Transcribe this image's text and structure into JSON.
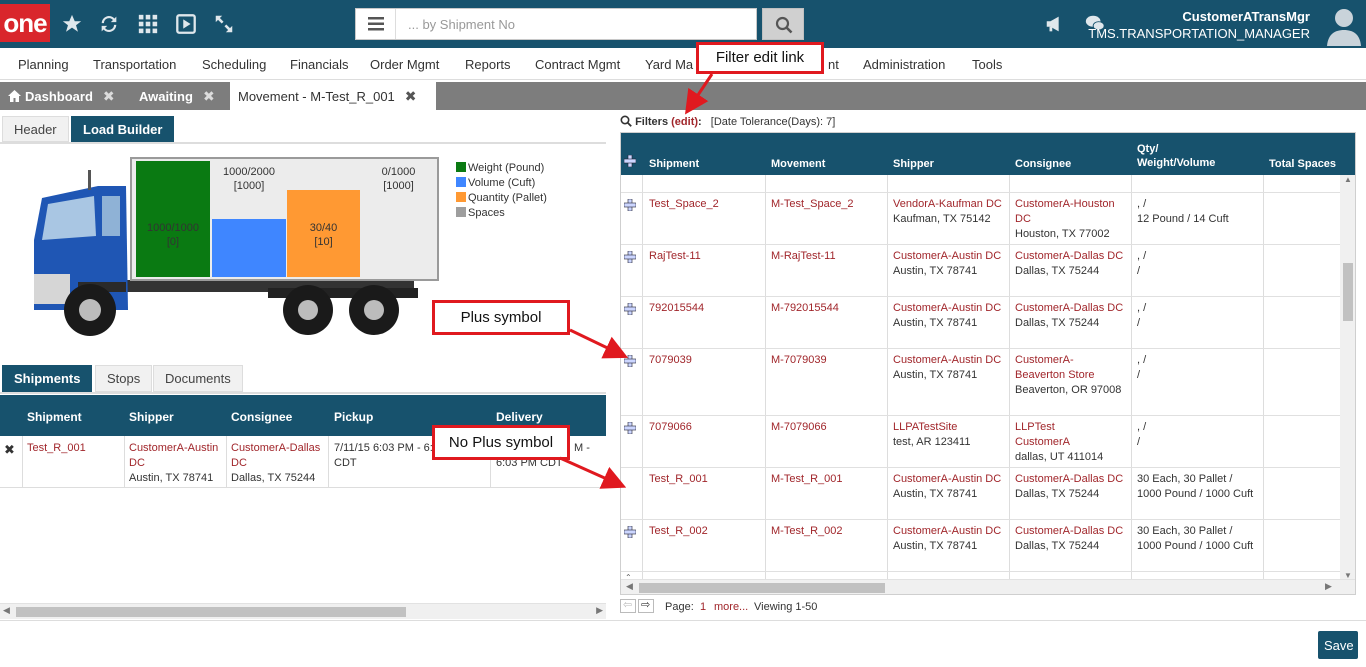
{
  "app": {
    "logo_text": "one",
    "search_placeholder": "... by Shipment No",
    "user_name": "CustomerATransMgr",
    "user_role": "TMS.TRANSPORTATION_MANAGER"
  },
  "menu": [
    "Planning",
    "Transportation",
    "Scheduling",
    "Financials",
    "Order Mgmt",
    "Reports",
    "Contract Mgmt",
    "Yard Ma",
    "nt",
    "Administration",
    "Tools"
  ],
  "tabs": [
    {
      "label": "Dashboard"
    },
    {
      "label": "Awaiting"
    },
    {
      "label": "Movement - M-Test_R_001"
    }
  ],
  "left": {
    "subtabs": [
      "Header",
      "Load Builder"
    ],
    "load": {
      "weight": {
        "label_top": "1000/1000",
        "label_bottom": "[0]",
        "fraction": 1.0
      },
      "volume": {
        "label_top": "1000/2000",
        "label_bottom": "[1000]",
        "fraction": 0.5
      },
      "quantity": {
        "label_top": "30/40",
        "label_bottom": "[10]",
        "fraction": 0.75
      },
      "spaces": {
        "label_top": "0/1000",
        "label_bottom": "[1000]",
        "fraction": 0.0
      }
    },
    "legend": [
      {
        "label": "Weight (Pound)",
        "color": "#0a7a12"
      },
      {
        "label": "Volume (Cuft)",
        "color": "#3f86ff"
      },
      {
        "label": "Quantity (Pallet)",
        "color": "#ff9933"
      },
      {
        "label": "Spaces",
        "color": "#9e9e9e"
      }
    ],
    "lower_tabs": [
      "Shipments",
      "Stops",
      "Documents"
    ],
    "columns": [
      "Shipment",
      "Shipper",
      "Consignee",
      "Pickup",
      "Delivery"
    ],
    "row": {
      "shipment": "Test_R_001",
      "shipper_name": "CustomerA-Austin DC",
      "shipper_addr": "Austin, TX 78741",
      "consignee_name": "CustomerA-Dallas DC",
      "consignee_addr": "Dallas, TX 75244",
      "pickup": "7/11/15 6:03 PM - 6:03 PM CDT",
      "delivery_1": "M -",
      "delivery_2": "6:03 PM CDT"
    }
  },
  "right": {
    "filters_label": "Filters",
    "filters_edit": "(edit)",
    "filters_value": "[Date Tolerance(Days): 7]",
    "columns": [
      "Shipment",
      "Movement",
      "Shipper",
      "Consignee",
      "Qty/",
      "Weight/Volume",
      "Total Spaces"
    ],
    "rows": [
      {
        "plus": true,
        "shipment": "Test_Space_2",
        "movement": "M-Test_Space_2",
        "shipper": [
          "VendorA-Kaufman DC",
          "Kaufman, TX 75142"
        ],
        "consignee": [
          "CustomerA-Houston",
          "DC",
          "Houston, TX 77002"
        ],
        "qty": [
          ", /",
          "12 Pound / 14 Cuft"
        ]
      },
      {
        "plus": true,
        "shipment": "RajTest-11",
        "movement": "M-RajTest-11",
        "shipper": [
          "CustomerA-Austin DC",
          "Austin, TX 78741"
        ],
        "consignee": [
          "CustomerA-Dallas DC",
          "Dallas, TX 75244"
        ],
        "qty": [
          ", /",
          "/"
        ]
      },
      {
        "plus": true,
        "shipment": "792015544",
        "movement": "M-792015544",
        "shipper": [
          "CustomerA-Austin DC",
          "Austin, TX 78741"
        ],
        "consignee": [
          "CustomerA-Dallas DC",
          "Dallas, TX 75244"
        ],
        "qty": [
          ", /",
          "/"
        ]
      },
      {
        "plus": true,
        "shipment": "7079039",
        "movement": "M-7079039",
        "shipper": [
          "CustomerA-Austin DC",
          "Austin, TX 78741"
        ],
        "consignee": [
          "CustomerA-",
          "Beaverton Store",
          "Beaverton, OR 97008"
        ],
        "qty": [
          ", /",
          "/"
        ]
      },
      {
        "plus": true,
        "shipment": "7079066",
        "movement": "M-7079066",
        "shipper": [
          "LLPATestSite",
          "test, AR 123411"
        ],
        "consignee": [
          "LLPTest",
          "CustomerA",
          "dallas, UT 411014"
        ],
        "qty": [
          ", /",
          "/"
        ]
      },
      {
        "plus": false,
        "shipment": "Test_R_001",
        "movement": "M-Test_R_001",
        "shipper": [
          "CustomerA-Austin DC",
          "Austin, TX 78741"
        ],
        "consignee": [
          "CustomerA-Dallas DC",
          "Dallas, TX 75244"
        ],
        "qty": [
          "30 Each, 30 Pallet /",
          "1000 Pound / 1000 Cuft"
        ]
      },
      {
        "plus": true,
        "shipment": "Test_R_002",
        "movement": "M-Test_R_002",
        "shipper": [
          "CustomerA-Austin DC",
          "Austin, TX 78741"
        ],
        "consignee": [
          "CustomerA-Dallas DC",
          "Dallas, TX 75244"
        ],
        "qty": [
          "30 Each, 30 Pallet /",
          "1000 Pound / 1000 Cuft"
        ]
      }
    ],
    "pager": {
      "label": "Page:",
      "current": "1",
      "more": "more...",
      "viewing": "Viewing 1-50"
    }
  },
  "footer": {
    "save_label": "Save"
  },
  "callouts": {
    "filter_edit": "Filter edit link",
    "plus": "Plus symbol",
    "no_plus": "No Plus symbol"
  },
  "colors": {
    "brand": "#17526d",
    "logo": "#d9262c",
    "link_red": "#a1262b",
    "callout": "#e0191f"
  }
}
